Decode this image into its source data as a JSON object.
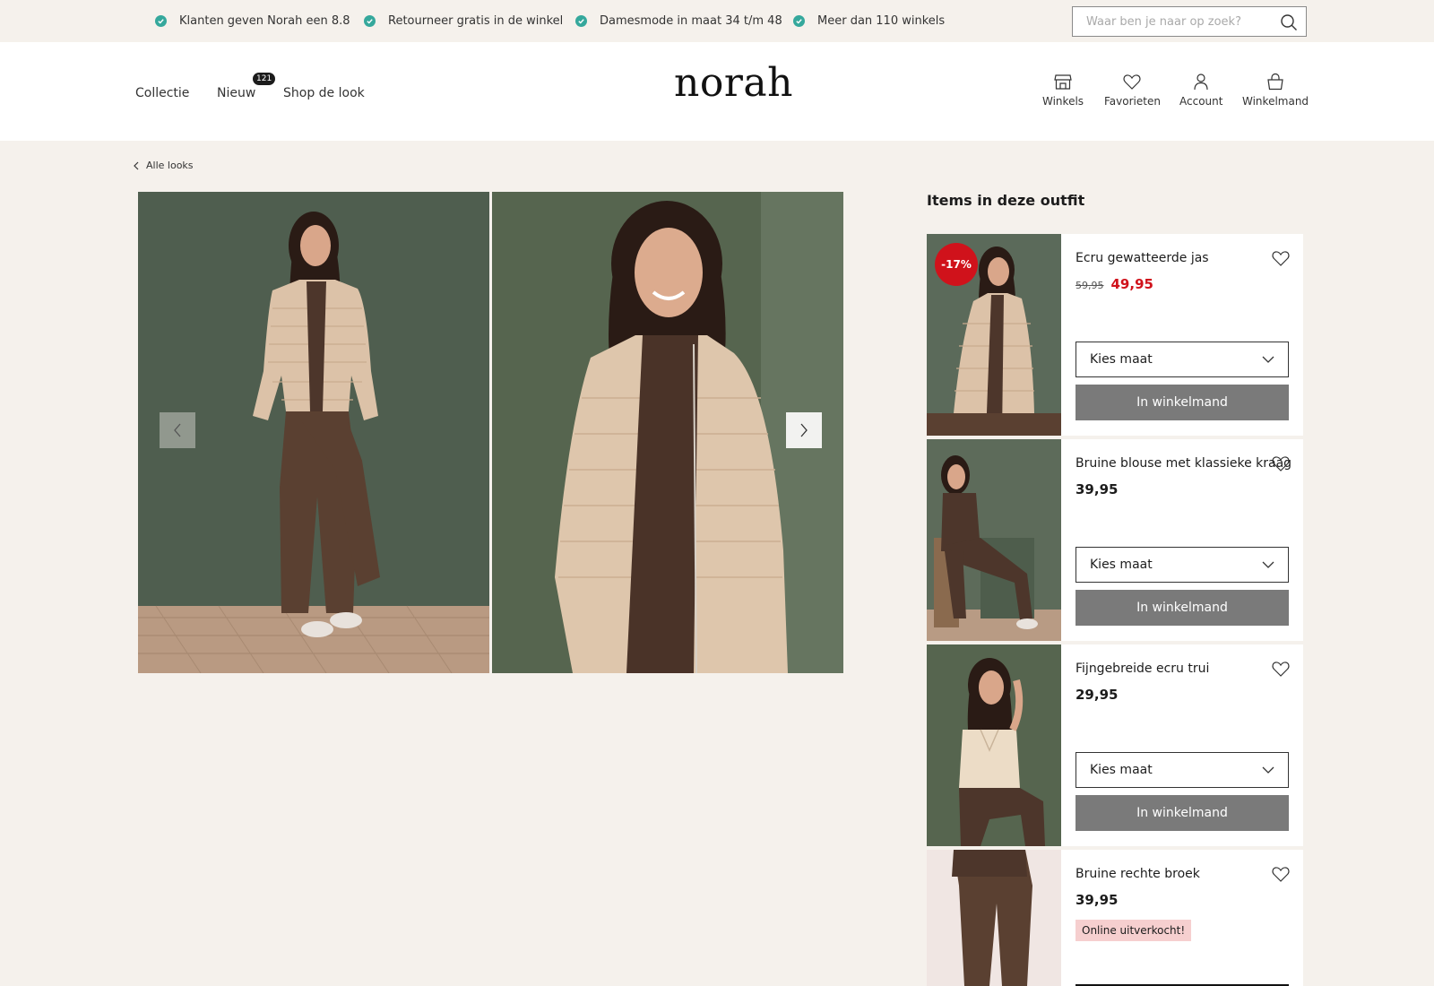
{
  "usp": [
    "Klanten geven Norah een 8.8",
    "Retourneer gratis in de winkel",
    "Damesmode in maat 34 t/m 48",
    "Meer dan 110 winkels"
  ],
  "search": {
    "placeholder": "Waar ben je naar op zoek?"
  },
  "nav": {
    "items": [
      "Collectie",
      "Nieuw",
      "Shop de look"
    ],
    "new_badge": "121"
  },
  "logo": "norah",
  "header_icons": {
    "stores": "Winkels",
    "favorites": "Favorieten",
    "account": "Account",
    "cart": "Winkelmand"
  },
  "breadcrumb": "Alle looks",
  "outfit": {
    "title": "Items in deze outfit",
    "items": [
      {
        "name": "Ecru gewatteerde jas",
        "old_price": "59,95",
        "price": "49,95",
        "badge": "-17%",
        "size_label": "Kies maat",
        "button": "In winkelmand"
      },
      {
        "name": "Bruine blouse met klassieke kraag",
        "price": "39,95",
        "size_label": "Kies maat",
        "button": "In winkelmand"
      },
      {
        "name": "Fijngebreide ecru trui",
        "price": "29,95",
        "size_label": "Kies maat",
        "button": "In winkelmand"
      },
      {
        "name": "Bruine rechte broek",
        "price": "39,95",
        "status": "Online uitverkocht!"
      }
    ]
  },
  "colors": {
    "background": "#f5f1ec",
    "accent_check": "#35a89c",
    "sale_red": "#d0121b",
    "button_grey": "#7a7a7a"
  }
}
